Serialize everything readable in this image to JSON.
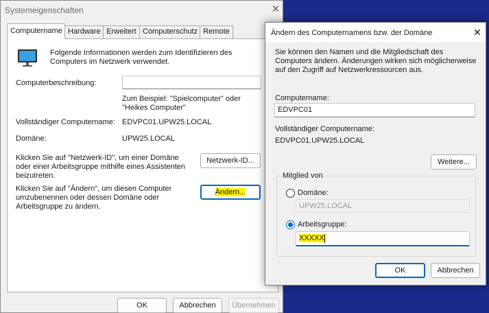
{
  "system_window": {
    "title": "Systemeigenschaften",
    "close_glyph": "✕",
    "tabs": [
      {
        "label": "Computername",
        "active": true
      },
      {
        "label": "Hardware",
        "active": false
      },
      {
        "label": "Erweitert",
        "active": false
      },
      {
        "label": "Computerschutz",
        "active": false
      },
      {
        "label": "Remote",
        "active": false
      }
    ],
    "intro_text": "Folgende Informationen werden zum Identifizieren des Computers im Netzwerk verwendet.",
    "description_label": "Computerbeschreibung:",
    "description_value": "",
    "description_hint": "Zum Beispiel: \"Spielcomputer\" oder \"Heikes Computer\"",
    "full_name_label": "Vollständiger Computername:",
    "full_name_value": "EDVPC01.UPW25.LOCAL",
    "domain_label": "Domäne:",
    "domain_value": "UPW25.LOCAL",
    "network_id_text": "Klicken Sie auf \"Netzwerk-ID\", um einer Domäne oder einer Arbeitsgruppe mithilfe eines Assistenten beizutreten.",
    "network_id_button": "Netzwerk-ID...",
    "change_text": "Klicken Sie auf \"Ändern\", um diesen Computer umzubenennen oder dessen Domäne oder Arbeitsgruppe zu ändern.",
    "change_button": "Ändern...",
    "ok_button": "OK",
    "cancel_button": "Abbrechen",
    "apply_button": "Übernehmen"
  },
  "change_dialog": {
    "title": "Ändern des Computernamens bzw. der Domäne",
    "close_glyph": "✕",
    "intro_text": "Sie können den Namen und die Mitgliedschaft des Computers ändern. Änderungen wirken sich möglicherweise auf den Zugriff auf Netzwerkressourcen aus.",
    "computer_name_label": "Computername:",
    "computer_name_value": "EDVPC01",
    "full_name_label": "Vollständiger Computername:",
    "full_name_value": "EDVPC01.UPW25.LOCAL",
    "more_button": "Weitere...",
    "member_of_label": "Mitglied von",
    "domain_option_label": "Domäne:",
    "domain_value": "UPW25.LOCAL",
    "workgroup_option_label": "Arbeitsgruppe:",
    "workgroup_value": "XXXXX",
    "ok_button": "OK",
    "cancel_button": "Abbrechen"
  },
  "colors": {
    "desktop": "#1a2a8a",
    "accent": "#0067c0",
    "highlight": "#fff200"
  }
}
